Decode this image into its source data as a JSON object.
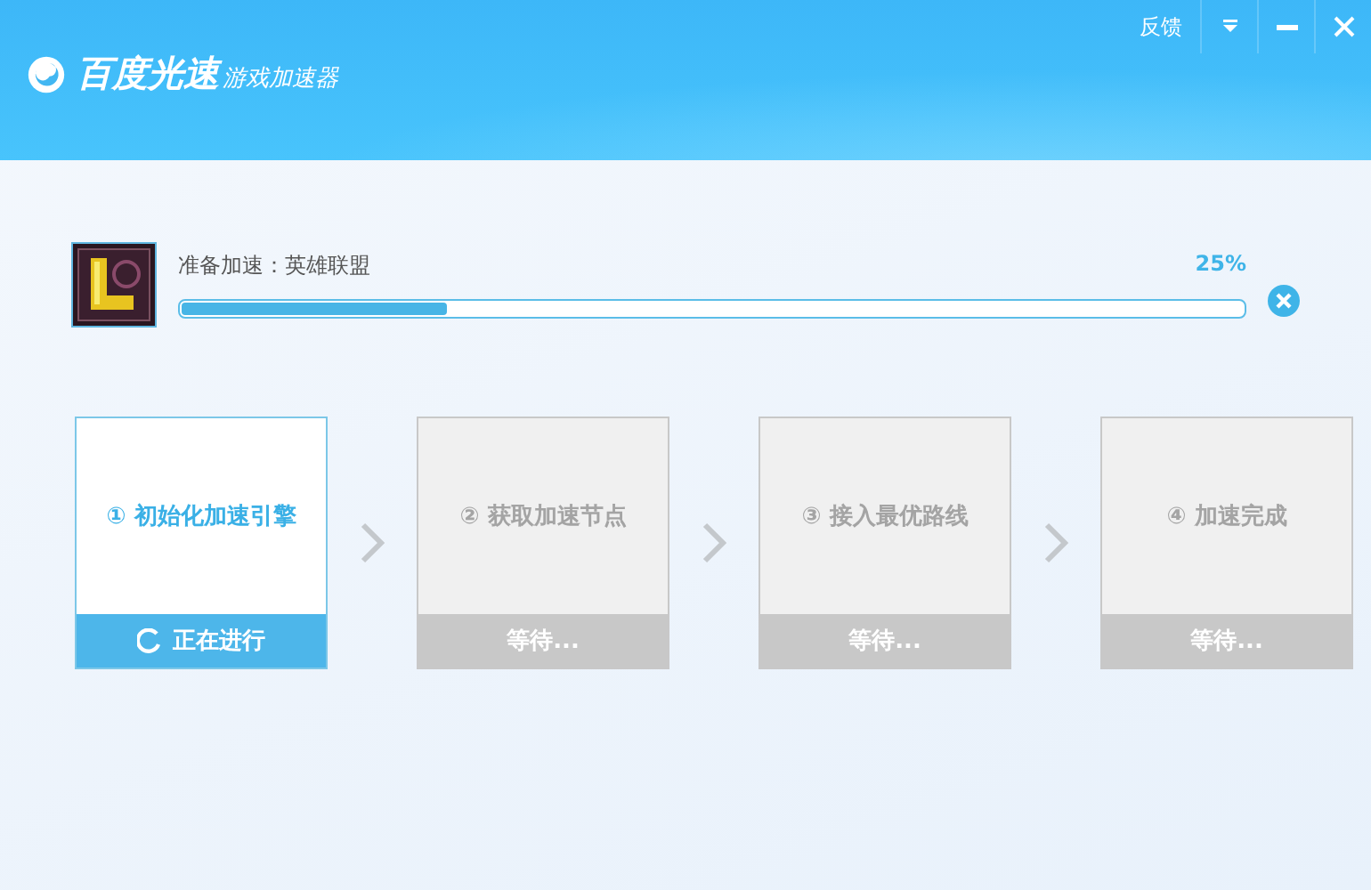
{
  "header": {
    "brand": "百度光速",
    "product": "游戏加速器",
    "feedback": "反馈"
  },
  "task": {
    "label": "准备加速：英雄联盟",
    "percent": "25%",
    "level": 0.25
  },
  "steps": [
    {
      "label": "① 初始化加速引擎",
      "status": "正在进行",
      "active": true
    },
    {
      "label": "② 获取加速节点",
      "status": "等待...",
      "active": false
    },
    {
      "label": "③ 接入最优路线",
      "status": "等待...",
      "active": false
    },
    {
      "label": "④ 加速完成",
      "status": "等待...",
      "active": false
    }
  ]
}
